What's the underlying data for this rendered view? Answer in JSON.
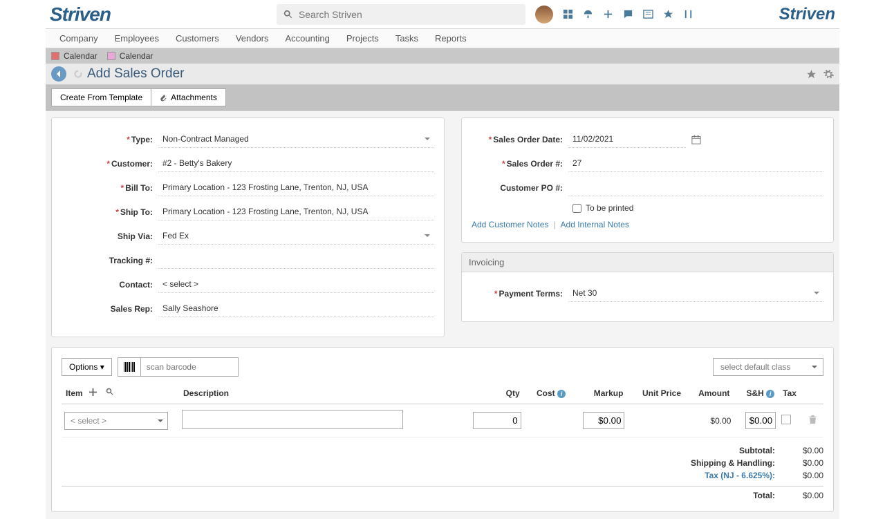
{
  "brand": "Striven",
  "search": {
    "placeholder": "Search Striven"
  },
  "mainnav": [
    "Company",
    "Employees",
    "Customers",
    "Vendors",
    "Accounting",
    "Projects",
    "Tasks",
    "Reports"
  ],
  "calbar": {
    "a": "Calendar",
    "b": "Calendar"
  },
  "page": {
    "title": "Add Sales Order"
  },
  "actions": {
    "template": "Create From Template",
    "attach": "Attachments"
  },
  "left": {
    "type_label": "Type:",
    "type_val": "Non-Contract Managed",
    "customer_label": "Customer:",
    "customer_val": "#2 - Betty's Bakery",
    "billto_label": "Bill To:",
    "billto_val": "Primary Location - 123 Frosting Lane, Trenton, NJ, USA",
    "shipto_label": "Ship To:",
    "shipto_val": "Primary Location - 123 Frosting Lane, Trenton, NJ, USA",
    "shipvia_label": "Ship Via:",
    "shipvia_val": "Fed Ex",
    "tracking_label": "Tracking #:",
    "tracking_val": "",
    "contact_label": "Contact:",
    "contact_val": "< select >",
    "rep_label": "Sales Rep:",
    "rep_val": "Sally Seashore"
  },
  "right": {
    "date_label": "Sales Order Date:",
    "date_val": "11/02/2021",
    "num_label": "Sales Order #:",
    "num_val": "27",
    "po_label": "Customer PO #:",
    "po_val": "",
    "print_label": "To be printed",
    "link1": "Add Customer Notes",
    "link2": "Add Internal Notes",
    "invoicing": "Invoicing",
    "terms_label": "Payment Terms:",
    "terms_val": "Net 30"
  },
  "items": {
    "options": "Options",
    "barcode_ph": "scan barcode",
    "class_ph": "select default class",
    "cols": {
      "item": "Item",
      "desc": "Description",
      "qty": "Qty",
      "cost": "Cost",
      "markup": "Markup",
      "unit": "Unit Price",
      "amount": "Amount",
      "sh": "S&H",
      "tax": "Tax"
    },
    "row": {
      "select": "< select >",
      "qty": "0",
      "markup": "$0.00",
      "amount": "$0.00",
      "sh": "$0.00"
    }
  },
  "totals": {
    "subtotal_l": "Subtotal:",
    "subtotal_v": "$0.00",
    "ship_l": "Shipping & Handling:",
    "ship_v": "$0.00",
    "tax_l": "Tax (NJ - 6.625%):",
    "tax_v": "$0.00",
    "total_l": "Total:",
    "total_v": "$0.00"
  }
}
